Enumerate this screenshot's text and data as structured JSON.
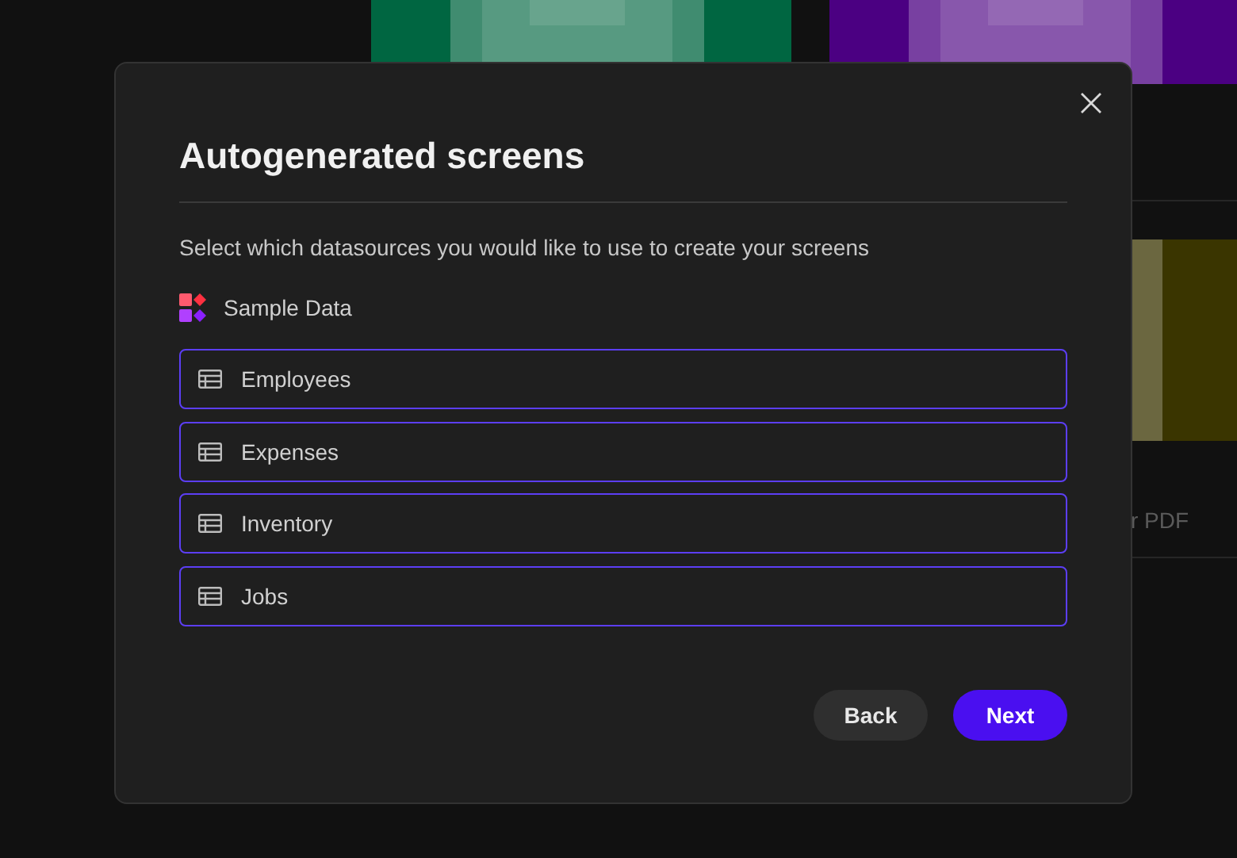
{
  "background": {
    "cards": [
      {
        "kind": "picture"
      },
      {
        "kind": "picture"
      },
      {
        "kind": "picture",
        "caption": "r PDF"
      }
    ]
  },
  "dialog": {
    "title": "Autogenerated screens",
    "subtitle": "Select which datasources you would like to use to create your screens",
    "source": {
      "label": "Sample Data"
    },
    "tables": [
      {
        "label": "Employees",
        "selected": true
      },
      {
        "label": "Expenses",
        "selected": true
      },
      {
        "label": "Inventory",
        "selected": true
      },
      {
        "label": "Jobs",
        "selected": true
      }
    ],
    "buttons": [
      {
        "label": "Back",
        "kind": "secondary"
      },
      {
        "label": "Next",
        "kind": "primary"
      }
    ]
  }
}
